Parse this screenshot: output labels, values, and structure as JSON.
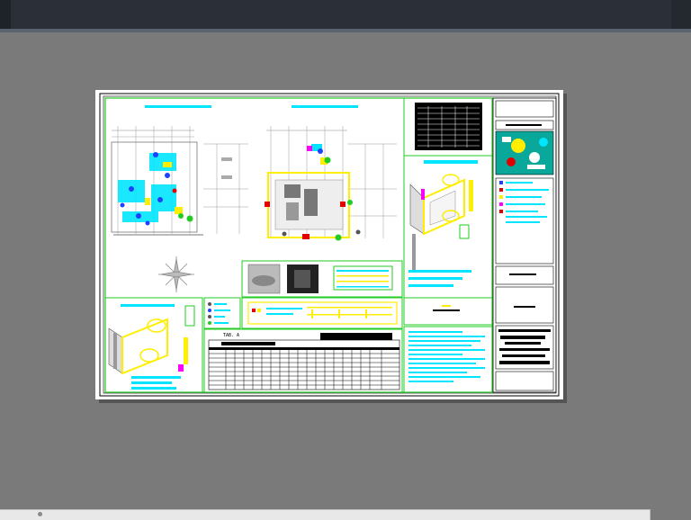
{
  "window": {
    "title": ""
  },
  "table": {
    "title": "TAB. A"
  },
  "colors": {
    "background": "#7a7a7a",
    "titlebar": "#2b3038",
    "sheet": "#ffffff",
    "frame_green": "#22cc22",
    "cyan_text": "#00e5ff",
    "yellow": "#ffee00",
    "magenta": "#ff00ff",
    "red": "#e00000",
    "blue": "#2040ff"
  }
}
